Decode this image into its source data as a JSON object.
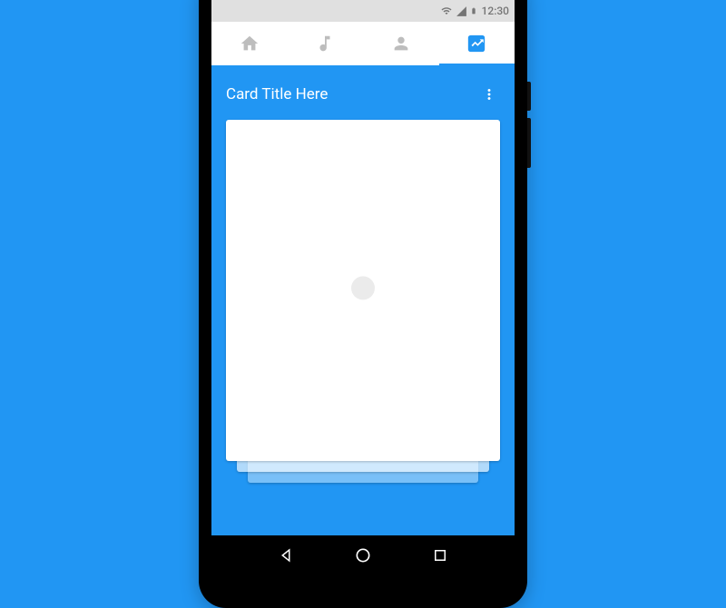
{
  "status": {
    "time": "12:30"
  },
  "tabs": {
    "active_index": 3
  },
  "card": {
    "title": "Card Title Here"
  }
}
